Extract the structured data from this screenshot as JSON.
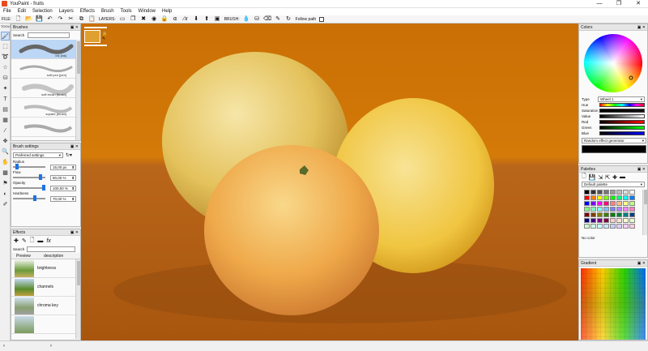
{
  "window": {
    "title": "YouPaint - fruits",
    "controls": [
      "—",
      "❐",
      "✕"
    ]
  },
  "menu": [
    "File",
    "Edit",
    "Selection",
    "Layers",
    "Effects",
    "Brush",
    "Tools",
    "Window",
    "Help"
  ],
  "toolbar": {
    "file_label": "FILE:",
    "layers_label": "LAYERS:",
    "brush_label": "BRUSH:",
    "follow_path_label": "Follow path"
  },
  "tools_header": "TOOLS",
  "brushes": {
    "title": "Brushes",
    "search_label": "Search",
    "search_value": "",
    "items": [
      {
        "name": "ink [ink]"
      },
      {
        "name": "soft pen [pen]"
      },
      {
        "name": "soft brush [brush]"
      },
      {
        "name": "square [brush]"
      }
    ]
  },
  "brush_settings": {
    "title": "Brush settings",
    "preset": "Preferred settings",
    "radius_label": "Radius",
    "radius_value": "15,00 px",
    "radius_fraction": 0.08,
    "flow_label": "Flow",
    "flow_value": "90,00 %",
    "flow_fraction": 0.9,
    "opacity_label": "Opacity",
    "opacity_value": "100,00 %",
    "opacity_fraction": 1.0,
    "hardness_label": "Hardness",
    "hardness_value": "70,00 %",
    "hardness_fraction": 0.7
  },
  "effects": {
    "title": "Effects",
    "search_label": "Search",
    "search_value": "",
    "col_preview": "Preview",
    "col_description": "description",
    "items": [
      {
        "name": "brightness"
      },
      {
        "name": "channels"
      },
      {
        "name": "chroma key"
      }
    ]
  },
  "colors": {
    "title": "Colors",
    "type_label": "Type",
    "type_value": "Wheel 1",
    "rows": [
      {
        "label": "Hue"
      },
      {
        "label": "Saturation"
      },
      {
        "label": "Value"
      },
      {
        "label": "Red"
      },
      {
        "label": "Green"
      },
      {
        "label": "Blue"
      }
    ],
    "generator": "Random effect generator",
    "current_color": "#000000"
  },
  "palettes": {
    "title": "Palettes",
    "selected": "Default palette",
    "no_color_label": "No color"
  },
  "gradient": {
    "title": "Gradient"
  },
  "palette_colors": [
    "#000000",
    "#333333",
    "#555555",
    "#777777",
    "#999999",
    "#bbbbbb",
    "#dddddd",
    "#ffffff",
    "#ff0000",
    "#ff8000",
    "#ffff00",
    "#80ff00",
    "#00ff00",
    "#00ff80",
    "#00ffff",
    "#0080ff",
    "#0000ff",
    "#8000ff",
    "#ff00ff",
    "#ff0080",
    "#ff8080",
    "#ffc080",
    "#ffff80",
    "#c0ff80",
    "#80ff80",
    "#80ffc0",
    "#80ffff",
    "#80c0ff",
    "#8080ff",
    "#c080ff",
    "#ff80ff",
    "#ff80c0",
    "#800000",
    "#804000",
    "#808000",
    "#408000",
    "#008000",
    "#008040",
    "#008080",
    "#004080",
    "#000080",
    "#400080",
    "#800080",
    "#800040",
    "#ffcccc",
    "#ffe5cc",
    "#ffffcc",
    "#e5ffcc",
    "#ccffcc",
    "#ccffe5",
    "#ccffff",
    "#cce5ff",
    "#ccccff",
    "#e5ccff",
    "#ffccff",
    "#ffcce5"
  ]
}
